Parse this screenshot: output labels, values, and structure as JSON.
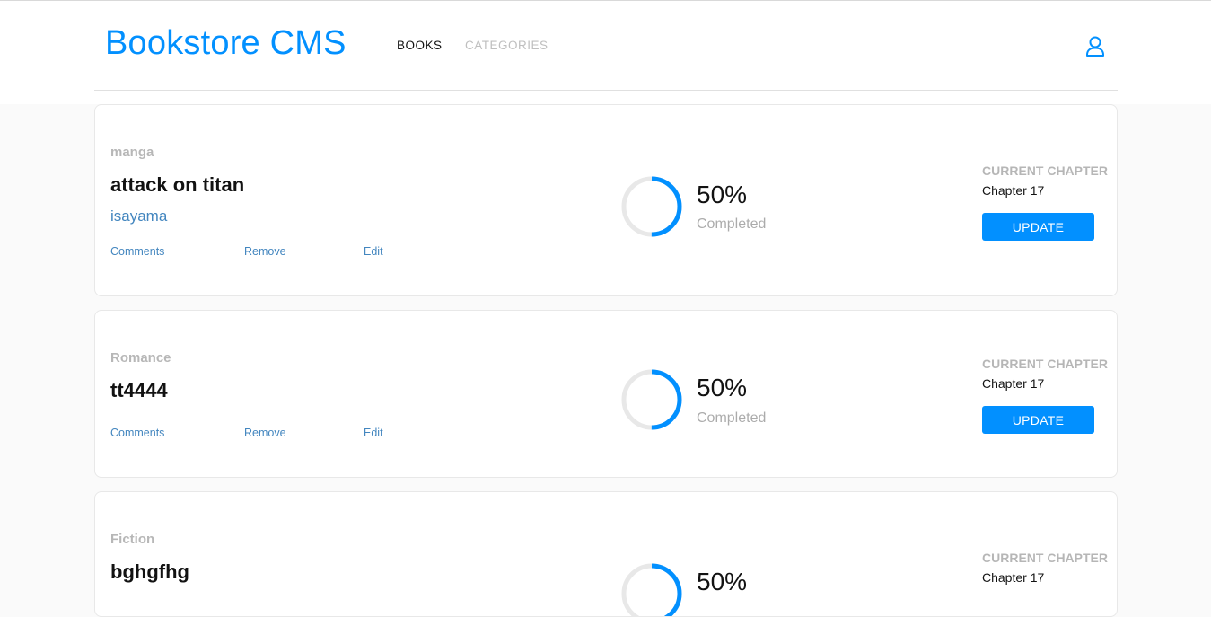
{
  "header": {
    "brand": "Bookstore CMS",
    "nav": {
      "books": "BOOKS",
      "categories": "CATEGORIES"
    },
    "user_icon": "user-icon"
  },
  "colors": {
    "accent": "#0290ff",
    "author": "#4386bf",
    "ring_track": "#e8e8e8"
  },
  "books": [
    {
      "genre": "manga",
      "title": "attack on titan",
      "author": "isayama",
      "actions": {
        "comments": "Comments",
        "remove": "Remove",
        "edit": "Edit"
      },
      "progress": {
        "percent": "50%",
        "value": 0.5,
        "label": "Completed"
      },
      "chapter": {
        "label": "CURRENT CHAPTER",
        "value": "Chapter 17",
        "button": "UPDATE"
      }
    },
    {
      "genre": "Romance",
      "title": "tt4444",
      "author": "",
      "actions": {
        "comments": "Comments",
        "remove": "Remove",
        "edit": "Edit"
      },
      "progress": {
        "percent": "50%",
        "value": 0.5,
        "label": "Completed"
      },
      "chapter": {
        "label": "CURRENT CHAPTER",
        "value": "Chapter 17",
        "button": "UPDATE"
      }
    },
    {
      "genre": "Fiction",
      "title": "bghgfhg",
      "author": "",
      "progress": {
        "percent": "50%",
        "value": 0.5
      },
      "chapter": {
        "label": "CURRENT CHAPTER",
        "value": "Chapter 17"
      }
    }
  ]
}
